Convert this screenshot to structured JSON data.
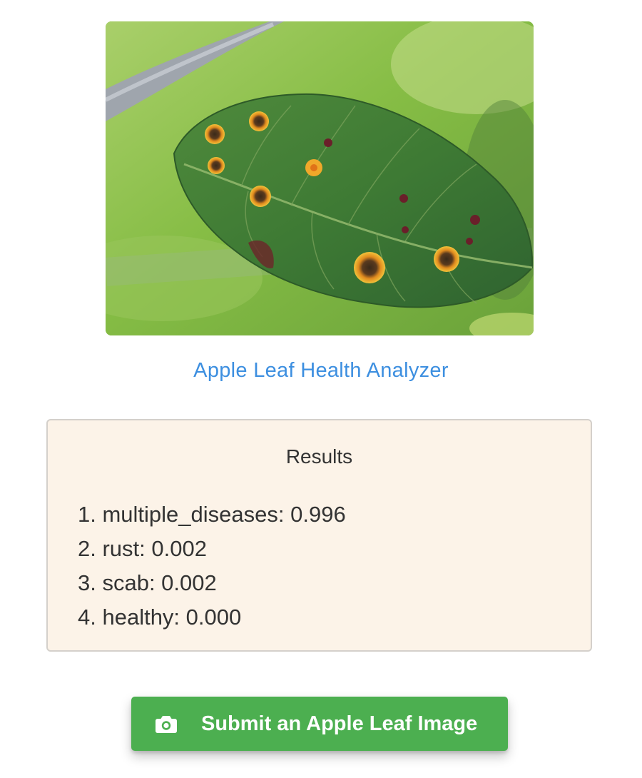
{
  "app": {
    "title": "Apple Leaf Health Analyzer"
  },
  "results": {
    "heading": "Results",
    "items": [
      "1. multiple_diseases: 0.996",
      "2. rust: 0.002",
      "3. scab: 0.002",
      "4. healthy: 0.000"
    ]
  },
  "submit": {
    "label": "Submit an Apple Leaf Image",
    "icon": "camera-icon"
  },
  "colors": {
    "title": "#3d8fe0",
    "card_background": "#fcf3e8",
    "button": "#4caf50"
  }
}
